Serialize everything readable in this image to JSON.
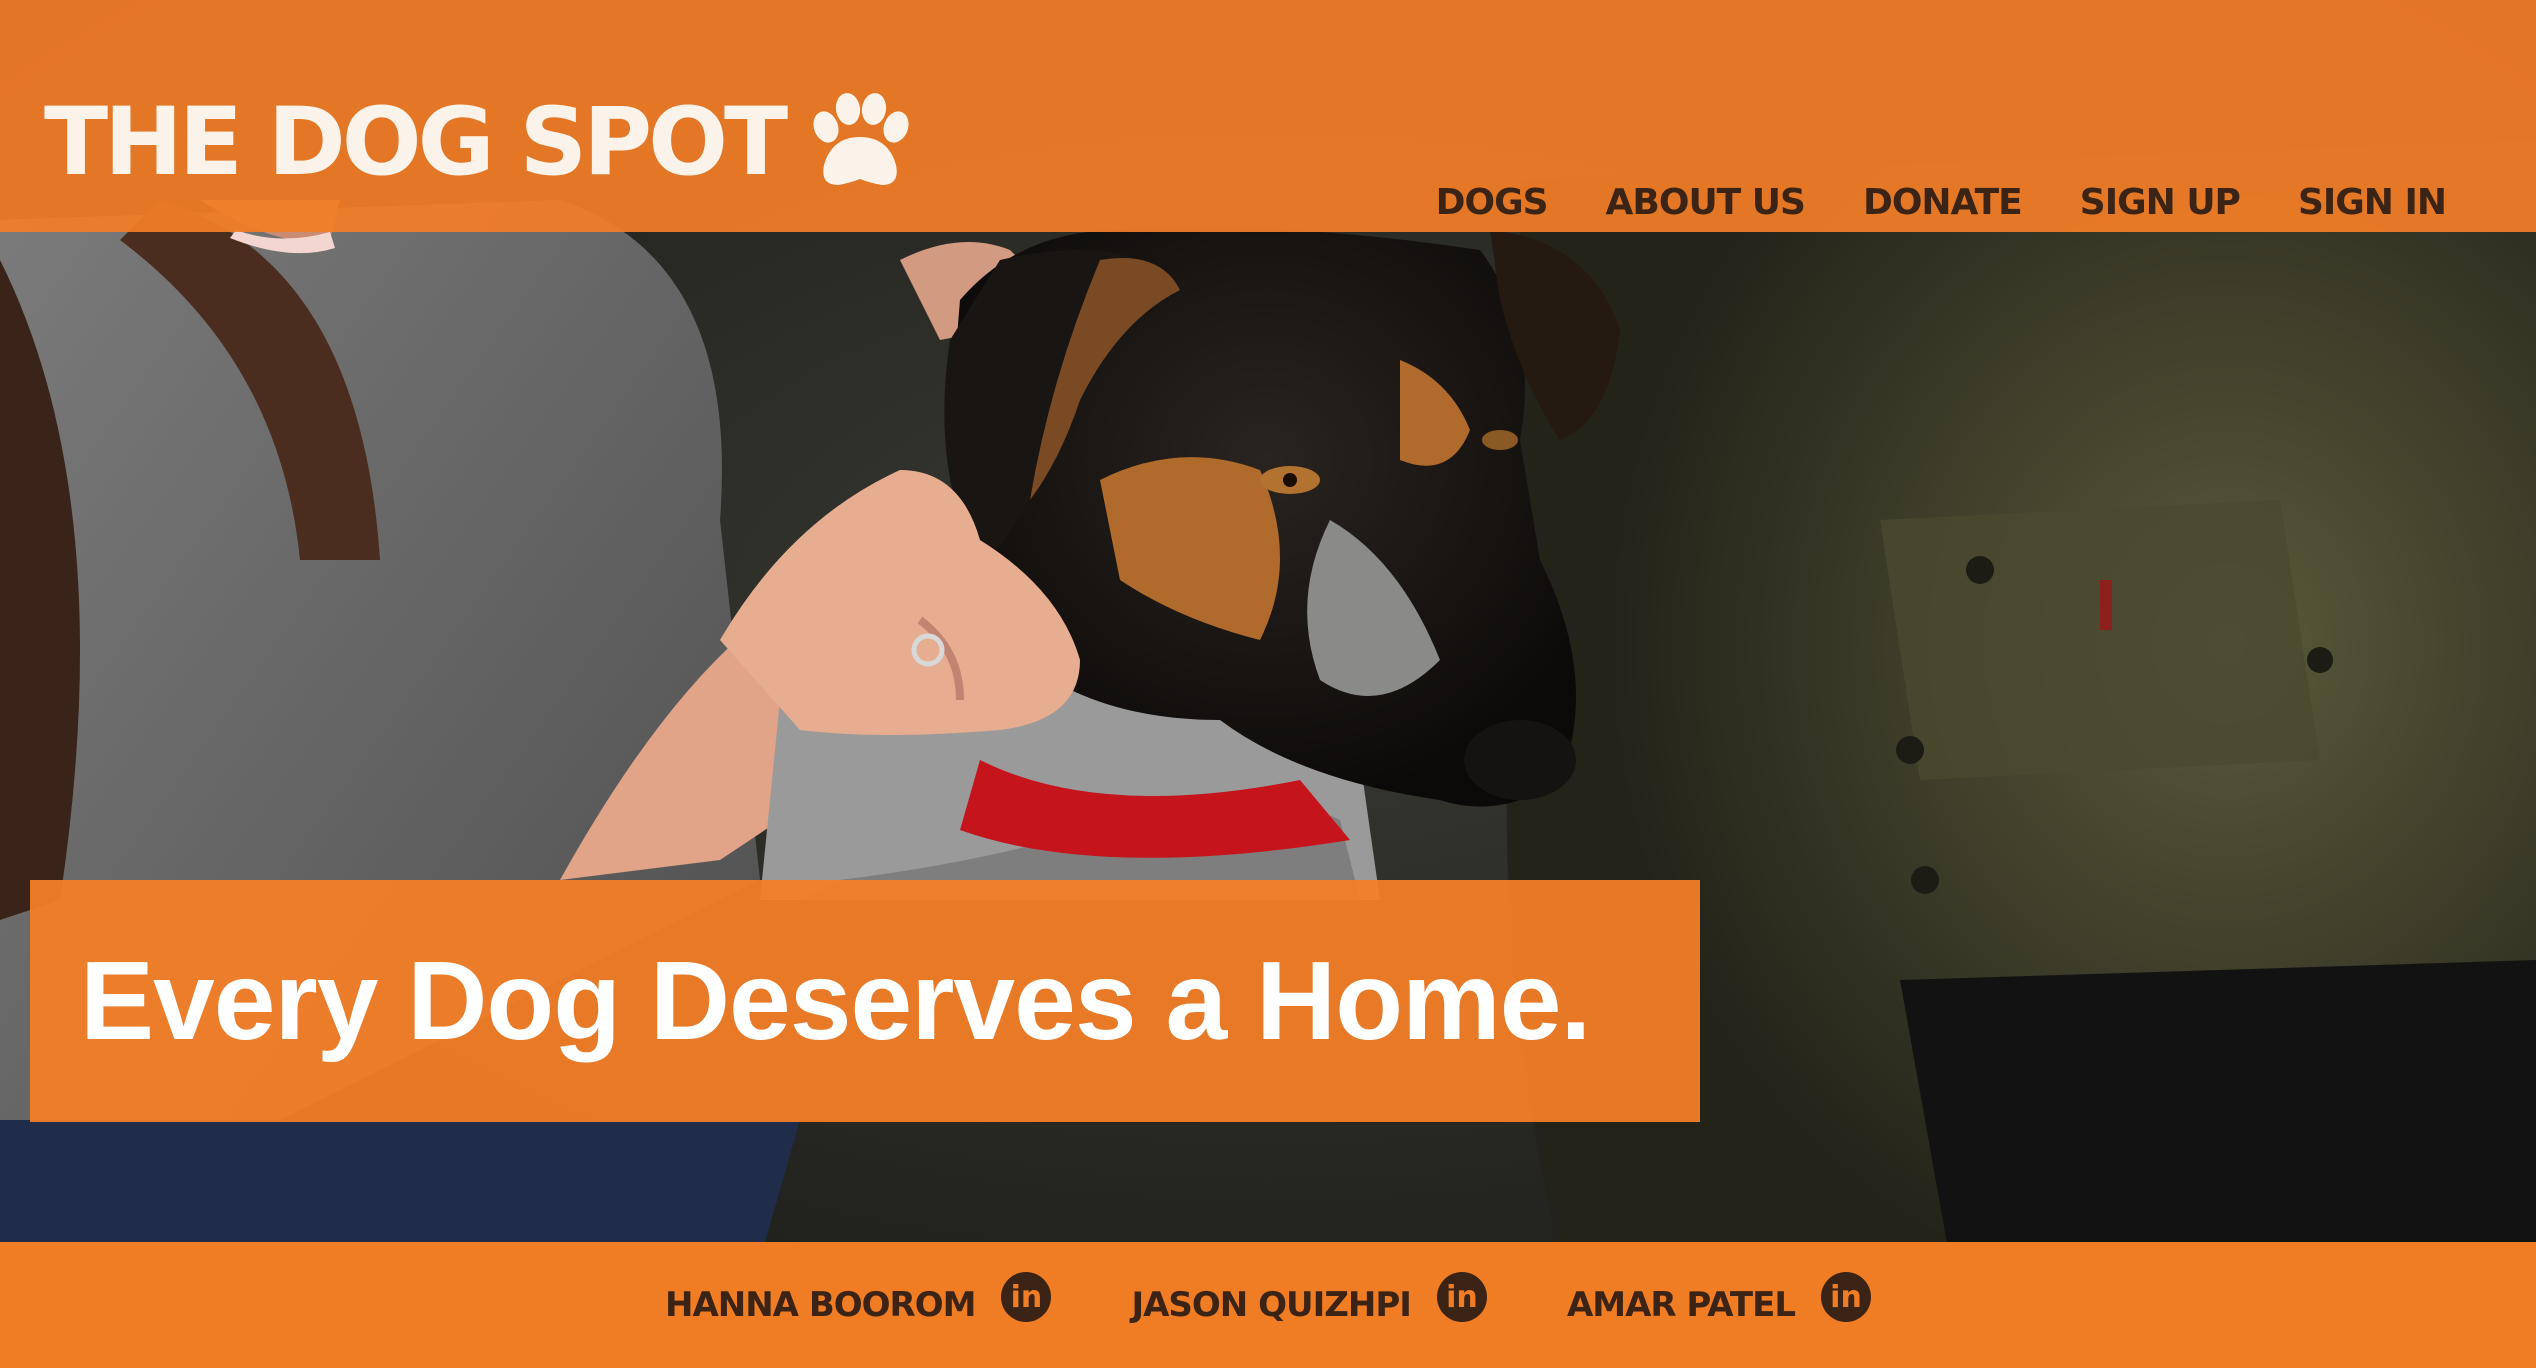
{
  "brand": {
    "name": "THE DOG SPOT",
    "accent_color": "#f37e27",
    "text_color": "#3b2416",
    "logo_icon": "paw-icon"
  },
  "nav": {
    "items": [
      {
        "label": "DOGS"
      },
      {
        "label": "ABOUT US"
      },
      {
        "label": "DONATE"
      },
      {
        "label": "SIGN UP"
      },
      {
        "label": "SIGN IN"
      }
    ]
  },
  "hero": {
    "headline": "Every Dog Deserves a Home."
  },
  "footer": {
    "credits": [
      {
        "name": "HANNA BOOROM",
        "icon": "linkedin-icon",
        "icon_text": "in"
      },
      {
        "name": "JASON QUIZHPI",
        "icon": "linkedin-icon",
        "icon_text": "in"
      },
      {
        "name": "AMAR PATEL",
        "icon": "linkedin-icon",
        "icon_text": "in"
      }
    ]
  }
}
